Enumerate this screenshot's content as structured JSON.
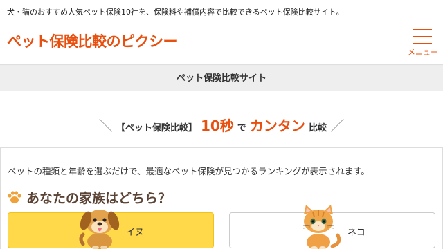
{
  "header": {
    "tagline": "犬・猫のおすすめ人気ペット保険10社を、保険料や補償内容で比較できるペット保険比較サイト。",
    "logo": "ペット保険比較のピクシー",
    "menu_label": "メニュー"
  },
  "subbar": {
    "title": "ペット保険比較サイト"
  },
  "catchphrase": {
    "bracket": "【ペット保険比較】",
    "seconds": "10秒",
    "de": "で",
    "easy": "カンタン",
    "compare": "比較"
  },
  "selector": {
    "intro": "ペットの種類と年齢を選ぶだけで、最適なペット保険が見つかるランキングが表示されます。",
    "question": "あなたの家族はどちら？",
    "options": [
      {
        "label": "イヌ",
        "selected": true,
        "icon": "dog-icon"
      },
      {
        "label": "ネコ",
        "selected": false,
        "icon": "cat-icon"
      }
    ]
  },
  "colors": {
    "accent": "#e8500f",
    "dog_button": "#ffd94a",
    "question_text": "#5a4334",
    "subbar_bg": "#eeeeee"
  }
}
